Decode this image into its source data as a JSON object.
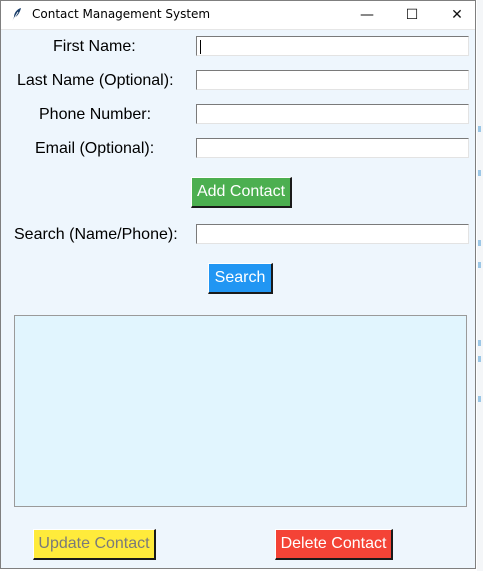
{
  "window": {
    "title": "Contact Management System",
    "controls": {
      "minimize": "—",
      "maximize": "☐",
      "close": "✕"
    }
  },
  "form": {
    "first_name_label": "First Name:",
    "last_name_label": "Last Name (Optional):",
    "phone_label": "Phone Number:",
    "email_label": "Email (Optional):",
    "first_name_value": "",
    "last_name_value": "",
    "phone_value": "",
    "email_value": ""
  },
  "add_button": "Add Contact",
  "search": {
    "label": "Search (Name/Phone):",
    "value": "",
    "button": "Search"
  },
  "contacts_list": [],
  "actions": {
    "update": "Update Contact",
    "delete": "Delete Contact"
  },
  "colors": {
    "window_bg": "#eef6fd",
    "list_bg": "#e1f5fe",
    "add": "#4caf50",
    "search": "#2196f3",
    "update": "#ffeb3b",
    "delete": "#f44336"
  },
  "icons": {
    "app": "feather-icon",
    "minimize": "minimize-icon",
    "maximize": "maximize-icon",
    "close": "close-icon"
  }
}
